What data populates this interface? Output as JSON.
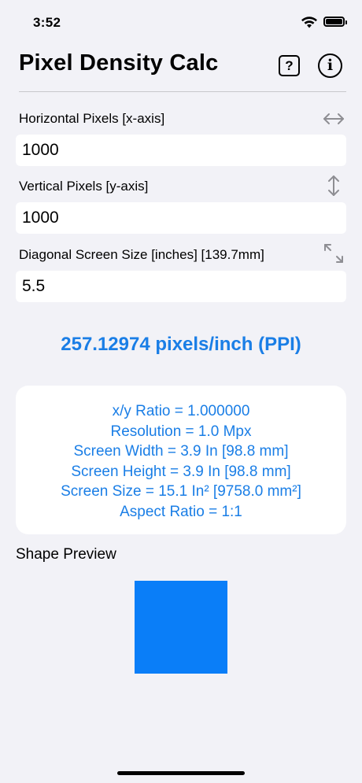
{
  "status_bar": {
    "time": "3:52"
  },
  "header": {
    "title": "Pixel Density Calc",
    "help_label": "?",
    "info_label": "i"
  },
  "fields": [
    {
      "label": "Horizontal Pixels  [x-axis]",
      "value": "1000",
      "icon": "horizontal-arrows-icon"
    },
    {
      "label": "Vertical Pixels [y-axis]",
      "value": "1000",
      "icon": "vertical-arrows-icon"
    },
    {
      "label": "Diagonal Screen Size [inches] [139.7mm]",
      "value": "5.5",
      "icon": "diagonal-arrows-icon"
    }
  ],
  "result": {
    "ppi": "257.12974 pixels/inch (PPI)"
  },
  "stats": [
    "x/y Ratio = 1.000000",
    "Resolution = 1.0 Mpx",
    "Screen Width = 3.9 In [98.8 mm]",
    "Screen Height = 3.9 In [98.8 mm]",
    "Screen Size = 15.1 In² [9758.0 mm²]",
    "Aspect Ratio = 1:1"
  ],
  "preview": {
    "label": "Shape Preview",
    "color": "#0a7ef8"
  },
  "colors": {
    "accent": "#1a7ee6",
    "background": "#f2f2f7"
  }
}
